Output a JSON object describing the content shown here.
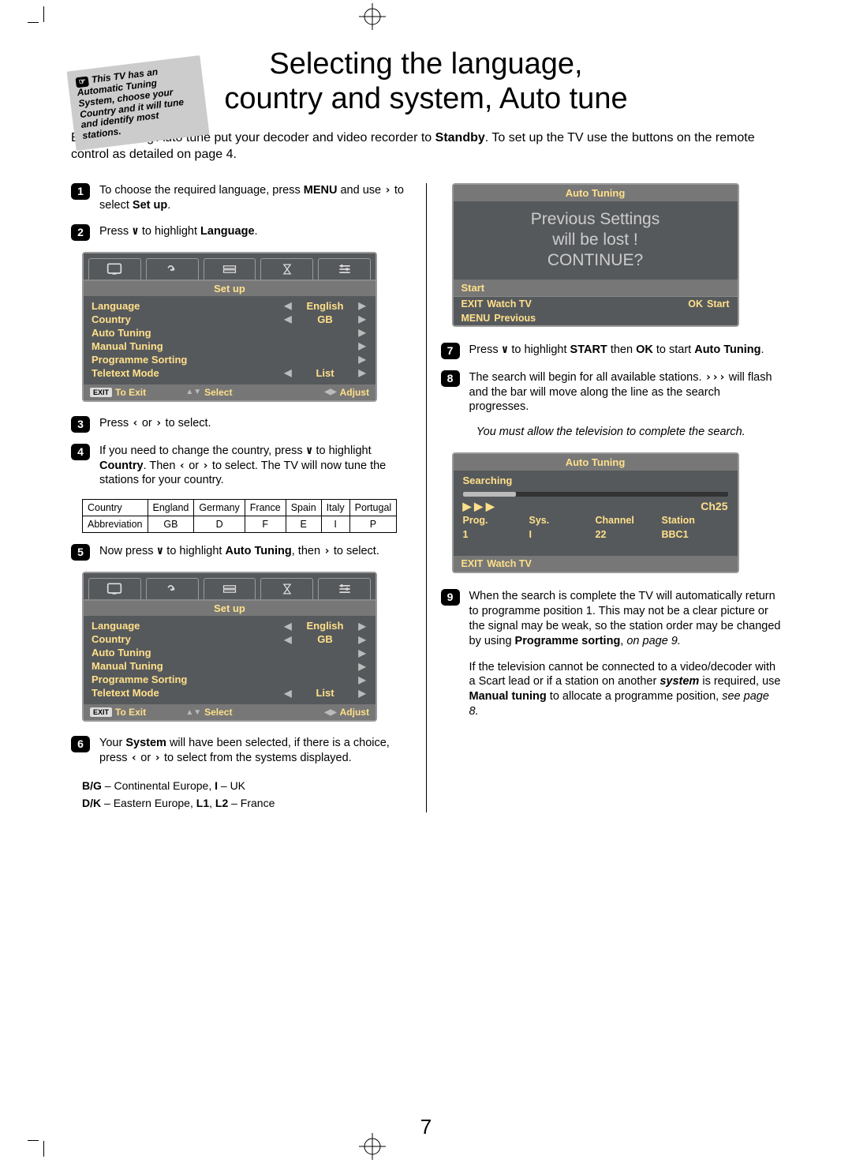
{
  "note": "This TV has an Automatic Tuning System, choose your Country and it will tune and identify most stations.",
  "title_line1": "Selecting the language,",
  "title_line2": "country and system, Auto tune",
  "intro_before": "Before running Auto tune put your decoder and video recorder to ",
  "intro_bold1": "Standby",
  "intro_after": ". To set up the TV use the buttons on the remote control as detailed on page 4.",
  "steps_left": [
    {
      "n": "1",
      "html": "To choose the required language, press <b>MENU</b> and use <span class='arrow'>›</span> to select <b>Set up</b>."
    },
    {
      "n": "2",
      "html": "Press <span class='arrow'>∨</span> to highlight <b>Language</b>."
    },
    {
      "n": "3",
      "html": "Press <span class='arrow'>‹</span> or <span class='arrow'>›</span> to select."
    },
    {
      "n": "4",
      "html": "If you need to change the country, press <span class='arrow'>∨</span> to highlight <b>Country</b>. Then <span class='arrow'>‹</span> or <span class='arrow'>›</span> to select. The TV will now tune the stations for your country."
    },
    {
      "n": "5",
      "html": "Now press <span class='arrow'>∨</span> to highlight <b>Auto Tuning</b>, then <span class='arrow'>›</span> to select."
    },
    {
      "n": "6",
      "html": "Your <b>System</b> will have been selected, if there is a choice, press <span class='arrow'>‹</span> or <span class='arrow'>›</span> to select from the systems displayed."
    }
  ],
  "steps_right": [
    {
      "n": "7",
      "html": "Press <span class='arrow'>∨</span> to highlight <b>START</b> then <b>OK</b> to start <b>Auto Tuning</b>."
    },
    {
      "n": "8",
      "html": "The search will begin for all available stations. <span class='arrow'>›››</span> will flash and the bar will move along the line as the search progresses."
    },
    {
      "n": "9",
      "html": "When the search is complete the TV will automatically return to programme position 1. This may not be a clear picture or the signal may be weak, so the station order may be changed by using <b>Programme sorting</b>, <i>on page 9.</i>"
    }
  ],
  "right_tail": "If the television cannot be connected to a video/decoder with a Scart lead or if a station on another <b><i>system</i></b> is required, use <b>Manual tuning</b> to allocate a programme position, <i>see page 8.</i>",
  "setup_menu": {
    "title": "Set up",
    "rows": [
      {
        "label": "Language",
        "val": "English",
        "larr": true,
        "rarr": true
      },
      {
        "label": "Country",
        "val": "GB",
        "larr": true,
        "rarr": true
      },
      {
        "label": "Auto Tuning",
        "val": "",
        "larr": false,
        "rarr": true
      },
      {
        "label": "Manual Tuning",
        "val": "",
        "larr": false,
        "rarr": true
      },
      {
        "label": "Programme Sorting",
        "val": "",
        "larr": false,
        "rarr": true
      },
      {
        "label": "Teletext Mode",
        "val": "List",
        "larr": true,
        "rarr": true
      }
    ],
    "statusbar": {
      "exit": "EXIT",
      "toexit": "To Exit",
      "select": "Select",
      "adjust": "Adjust"
    }
  },
  "country_table": {
    "header": [
      "Country",
      "England",
      "Germany",
      "France",
      "Spain",
      "Italy",
      "Portugal"
    ],
    "row": [
      "Abbreviation",
      "GB",
      "D",
      "F",
      "E",
      "I",
      "P"
    ]
  },
  "system_note_line1": "<b>B/G</b> – Continental Europe, <b>I</b> – UK",
  "system_note_line2": "<b>D/K</b> – Eastern Europe, <b>L1</b>, <b>L2</b> – France",
  "auto_tuning1": {
    "title": "Auto Tuning",
    "line1": "Previous Settings",
    "line2": "will be lost !",
    "line3": "CONTINUE?",
    "start": "Start",
    "exit": "EXIT",
    "watch": "Watch TV",
    "ok": "OK",
    "startbtn": "Start",
    "menu": "MENU",
    "previous": "Previous"
  },
  "italic_note": "You must allow the television to complete the search.",
  "auto_tuning2": {
    "title": "Auto Tuning",
    "searching": "Searching",
    "ch": "Ch25",
    "hdr": [
      "Prog.",
      "Sys.",
      "Channel",
      "Station"
    ],
    "row": [
      "1",
      "I",
      "22",
      "BBC1"
    ],
    "exit": "EXIT",
    "watch": "Watch TV"
  },
  "page_number": "7"
}
